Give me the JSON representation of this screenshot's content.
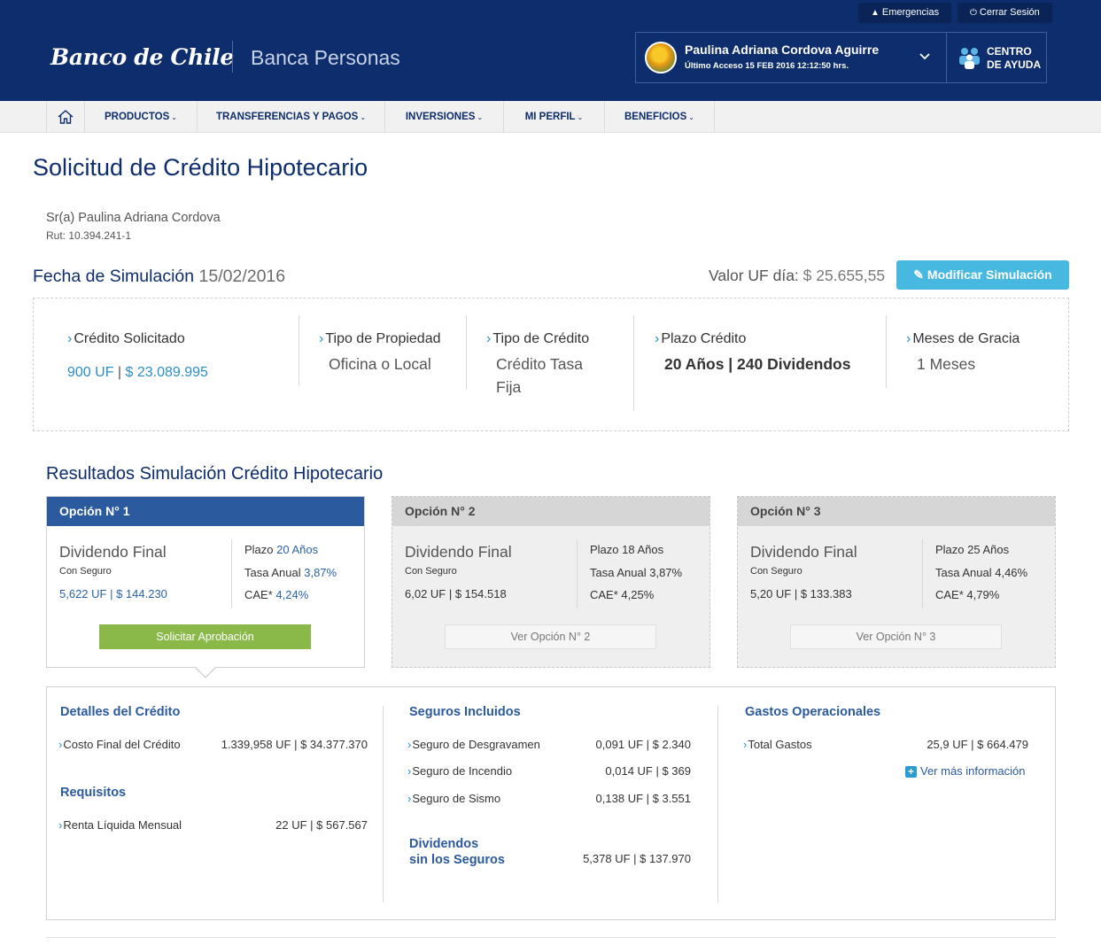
{
  "header": {
    "emergencias": "Emergencias",
    "cerrar_sesion": "Cerrar Sesión",
    "logo": "Banco de Chile",
    "subtitle": "Banca Personas",
    "user_name": "Paulina Adriana Cordova Aguirre",
    "last_access": "Último Acceso 15 FEB 2016 12:12:50 hrs.",
    "help_line1": "CENTRO",
    "help_line2": "DE AYUDA"
  },
  "nav": {
    "items": [
      "PRODUCTOS",
      "TRANSFERENCIAS Y PAGOS",
      "INVERSIONES",
      "MI PERFIL",
      "BENEFICIOS"
    ]
  },
  "page": {
    "title": "Solicitud de Crédito Hipotecario",
    "client_name": "Sr(a) Paulina Adriana Cordova",
    "client_rut": "Rut: 10.394.241-1",
    "sim_date_label": "Fecha de Simulación",
    "sim_date_value": "15/02/2016",
    "uf_label": "Valor UF día:",
    "uf_value": "$ 25.655,55",
    "modify_button": "Modificar Simulación"
  },
  "summary": {
    "credito_label": "Crédito Solicitado",
    "credito_uf": "900 UF",
    "credito_sep": "|",
    "credito_clp": "$ 23.089.995",
    "propiedad_label": "Tipo de Propiedad",
    "propiedad_value": "Oficina o Local",
    "tipo_label": "Tipo de Crédito",
    "tipo_value_1": "Crédito Tasa",
    "tipo_value_2": "Fija",
    "plazo_label": "Plazo Crédito",
    "plazo_value": "20 Años | 240 Dividendos",
    "gracia_label": "Meses de Gracia",
    "gracia_value": "1 Meses"
  },
  "results": {
    "title": "Resultados Simulación Crédito Hipotecario",
    "dividend_title": "Dividendo Final",
    "con_seguro": "Con Seguro",
    "plazo_label": "Plazo",
    "tasa_label": "Tasa Anual",
    "cae_label": "CAE*",
    "options": [
      {
        "name": "Opción N° 1",
        "amount": "5,622 UF | $ 144.230",
        "plazo": "20 Años",
        "tasa": "3,87%",
        "cae": "4,24%",
        "button": "Solicitar Aprobación"
      },
      {
        "name": "Opción N° 2",
        "amount": "6,02 UF | $ 154.518",
        "plazo": "18 Años",
        "tasa": "3,87%",
        "cae": "4,25%",
        "button": "Ver Opción N° 2"
      },
      {
        "name": "Opción N° 3",
        "amount": "5,20 UF | $ 133.383",
        "plazo": "25 Años",
        "tasa": "4,46%",
        "cae": "4,79%",
        "button": "Ver Opción N° 3"
      }
    ]
  },
  "details": {
    "credito_title": "Detalles del Crédito",
    "costo_label": "Costo Final del Crédito",
    "costo_value": "1.339,958 UF | $ 34.377.370",
    "requisitos_title": "Requisitos",
    "renta_label": "Renta Líquida Mensual",
    "renta_value": "22 UF | $ 567.567",
    "seguros_title": "Seguros Incluidos",
    "seguros": [
      {
        "label": "Seguro de Desgravamen",
        "value": "0,091 UF | $ 2.340"
      },
      {
        "label": "Seguro de Incendio",
        "value": "0,014 UF | $ 369"
      },
      {
        "label": "Seguro de Sismo",
        "value": "0,138 UF | $ 3.551"
      }
    ],
    "sin_seguros_1": "Dividendos",
    "sin_seguros_2": "sin los Seguros",
    "sin_seguros_value": "5,378 UF | $ 137.970",
    "gastos_title": "Gastos Operacionales",
    "total_gastos_label": "Total Gastos",
    "total_gastos_value": "25,9 UF | $ 664.479",
    "more_info": "Ver más información"
  }
}
